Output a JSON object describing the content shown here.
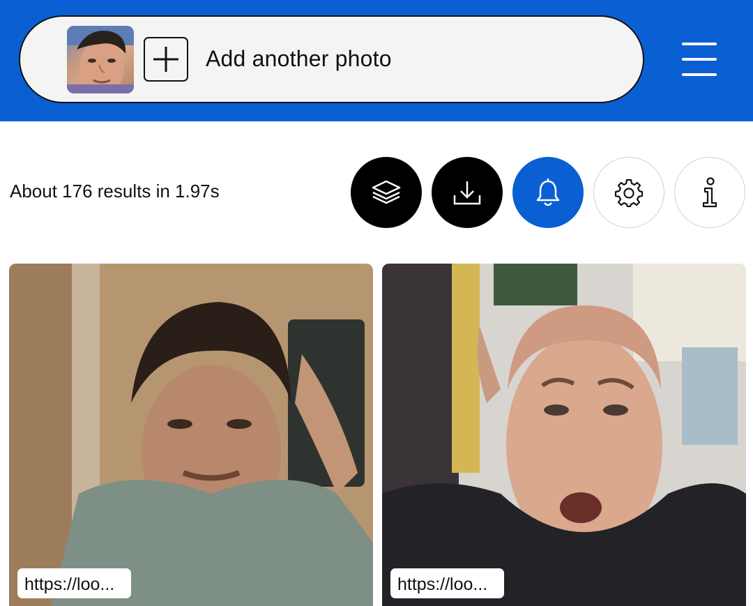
{
  "header": {
    "add_photo_label": "Add another photo",
    "menu_icon": "hamburger-menu-icon",
    "colors": {
      "brand_blue": "#0a5fd3"
    }
  },
  "results": {
    "summary": "About 176 results in 1.97s"
  },
  "actions": [
    {
      "icon": "layers-icon",
      "style": "dark"
    },
    {
      "icon": "download-icon",
      "style": "dark"
    },
    {
      "icon": "bell-icon",
      "style": "blue"
    },
    {
      "icon": "gear-icon",
      "style": "light"
    },
    {
      "icon": "info-icon",
      "style": "light"
    }
  ],
  "cards": [
    {
      "url": "https://loo..."
    },
    {
      "url": "https://loo..."
    }
  ]
}
